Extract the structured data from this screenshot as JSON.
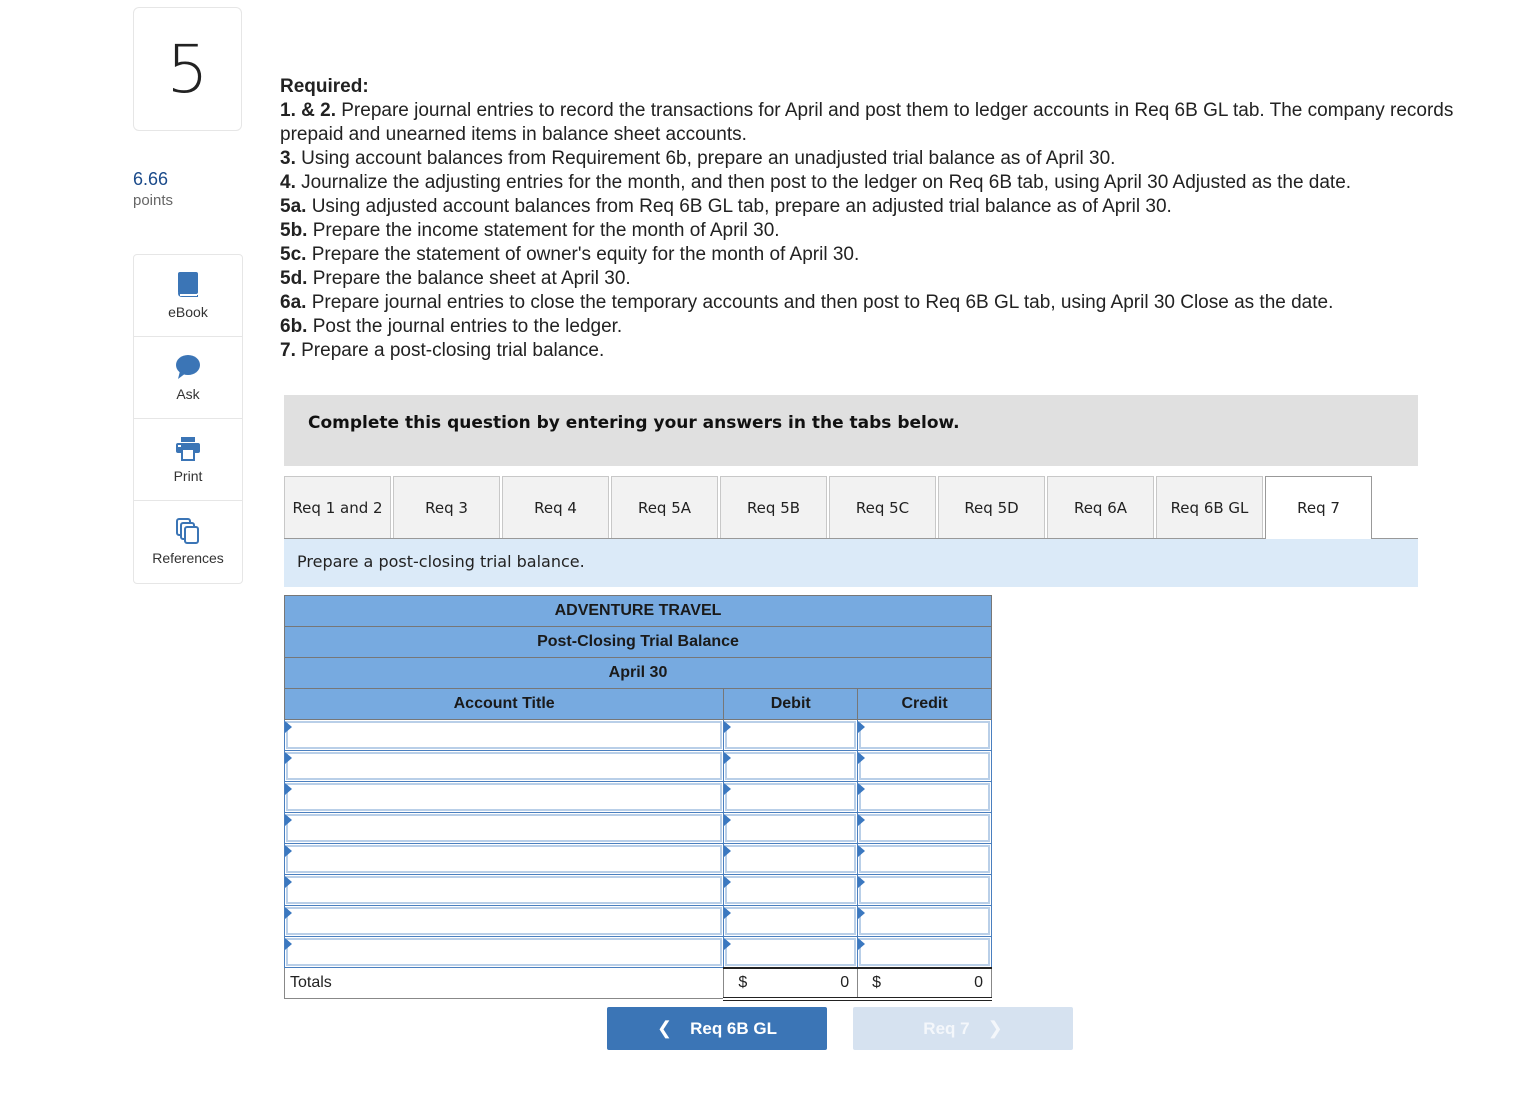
{
  "question": {
    "number": "5",
    "points_value": "6.66",
    "points_label": "points"
  },
  "tools": [
    {
      "label": "eBook",
      "icon": "book-icon"
    },
    {
      "label": "Ask",
      "icon": "speech-bubble-icon"
    },
    {
      "label": "Print",
      "icon": "printer-icon"
    },
    {
      "label": "References",
      "icon": "copy-pages-icon"
    }
  ],
  "required": {
    "heading": "Required:",
    "items": [
      {
        "num": "1. & 2.",
        "text": " Prepare journal entries to record the transactions for April and post them to ledger accounts in Req 6B GL tab. The company records prepaid and unearned items in balance sheet accounts."
      },
      {
        "num": "3.",
        "text": " Using account balances from Requirement 6b, prepare an unadjusted trial balance as of April 30."
      },
      {
        "num": "4.",
        "text": " Journalize the adjusting entries for the month, and then post to the ledger on Req 6B tab, using April 30 Adjusted as the date."
      },
      {
        "num": "5a.",
        "text": " Using adjusted account balances from Req 6B GL tab, prepare an adjusted trial balance as of April 30."
      },
      {
        "num": "5b.",
        "text": " Prepare the income statement for the month of April 30."
      },
      {
        "num": "5c.",
        "text": " Prepare the statement of owner's equity for the month of April 30."
      },
      {
        "num": "5d.",
        "text": " Prepare the balance sheet at April 30."
      },
      {
        "num": "6a.",
        "text": " Prepare journal entries to close the temporary accounts and then post to Req 6B GL tab, using April 30 Close as the date."
      },
      {
        "num": "6b.",
        "text": " Post the journal entries to the ledger."
      },
      {
        "num": "7.",
        "text": " Prepare a post-closing trial balance."
      }
    ]
  },
  "banner": "Complete this question by entering your answers in the tabs below.",
  "tabs": [
    "Req 1 and 2",
    "Req 3",
    "Req 4",
    "Req 5A",
    "Req 5B",
    "Req 5C",
    "Req 5D",
    "Req 6A",
    "Req 6B GL",
    "Req 7"
  ],
  "active_tab": "Req 7",
  "instruction": "Prepare a post-closing trial balance.",
  "trial_balance": {
    "company": "ADVENTURE TRAVEL",
    "title": "Post-Closing Trial Balance",
    "date": "April 30",
    "columns": {
      "account": "Account Title",
      "debit": "Debit",
      "credit": "Credit"
    },
    "rows": [
      {
        "account": "",
        "debit": "",
        "credit": ""
      },
      {
        "account": "",
        "debit": "",
        "credit": ""
      },
      {
        "account": "",
        "debit": "",
        "credit": ""
      },
      {
        "account": "",
        "debit": "",
        "credit": ""
      },
      {
        "account": "",
        "debit": "",
        "credit": ""
      },
      {
        "account": "",
        "debit": "",
        "credit": ""
      },
      {
        "account": "",
        "debit": "",
        "credit": ""
      },
      {
        "account": "",
        "debit": "",
        "credit": ""
      }
    ],
    "totals": {
      "label": "Totals",
      "currency": "$",
      "debit": "0",
      "credit": "0"
    }
  },
  "nav": {
    "prev_label": "Req 6B GL",
    "next_label": "Req 7"
  }
}
